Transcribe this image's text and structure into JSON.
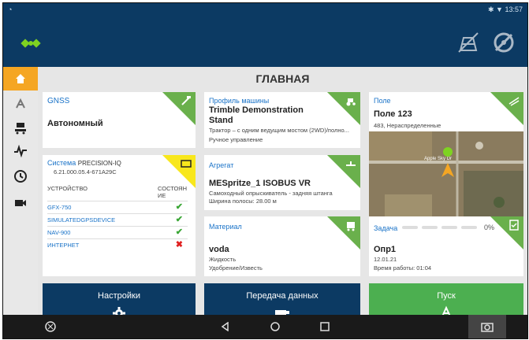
{
  "statusbar": {
    "time": "13:57",
    "indicators": "✱ ▼"
  },
  "appbar": {
    "logo_icon": "satellite-icon",
    "field_icon": "field-icon",
    "no_steer_icon": "no-steering-icon"
  },
  "sidebar": {
    "items": [
      {
        "icon": "home-icon",
        "active": true
      },
      {
        "icon": "guidance-icon",
        "active": false
      },
      {
        "icon": "implement-icon",
        "active": false
      },
      {
        "icon": "pulse-icon",
        "active": false
      },
      {
        "icon": "timer-icon",
        "active": false
      },
      {
        "icon": "camera-icon",
        "active": false
      }
    ]
  },
  "main": {
    "title": "ГЛАВНАЯ"
  },
  "gnss": {
    "label": "GNSS",
    "value": "Автономный"
  },
  "machine": {
    "label": "Профиль машины",
    "name_line1": "Trimble Demonstration",
    "name_line2": "Stand",
    "desc": "Трактор – с одним ведущим мостом (2WD)/полно...",
    "steering": "Ручное управление"
  },
  "field": {
    "label": "Поле",
    "name": "Поле 123",
    "desc": "483, Нераспределенные",
    "map_road": "Apple Sky Dr"
  },
  "system": {
    "label": "Система",
    "model": "PRECISION-IQ",
    "version": "6.21.000.05.4-671A29C",
    "col_device": "УСТРОЙСТВО",
    "col_state_1": "СОСТОЯН",
    "col_state_2": "ИЕ",
    "devices": [
      {
        "name": "GFX-750",
        "status": "ok"
      },
      {
        "name": "SIMULATEDGPSDEVICE",
        "status": "ok"
      },
      {
        "name": "NAV-900",
        "status": "ok"
      },
      {
        "name": "ИНТЕРНЕТ",
        "status": "error"
      }
    ],
    "ok_mark": "✔",
    "err_mark": "✖"
  },
  "implement": {
    "label": "Агрегат",
    "name": "MESpritze_1 ISOBUS VR",
    "desc": "Самоходный опрыскиватель - задняя штанга",
    "width": "Ширина полосы: 28.00 м"
  },
  "material": {
    "label": "Материал",
    "name": "voda",
    "type": "Жидкость",
    "category": "Удобрение/Известь"
  },
  "task": {
    "label": "Задача",
    "progress": "0%",
    "progress_fraction": 0,
    "name": "Опр1",
    "date": "12.01.21",
    "worktime": "Время работы: 01:04"
  },
  "buttons": {
    "settings": "Настройки",
    "transfer": "Передача данных",
    "run": "Пуск"
  },
  "colors": {
    "appbar": "#0c3a63",
    "accent": "#f5a623",
    "green": "#6ab04c",
    "button_blue": "#0c3a63",
    "button_green": "#4caf50"
  }
}
